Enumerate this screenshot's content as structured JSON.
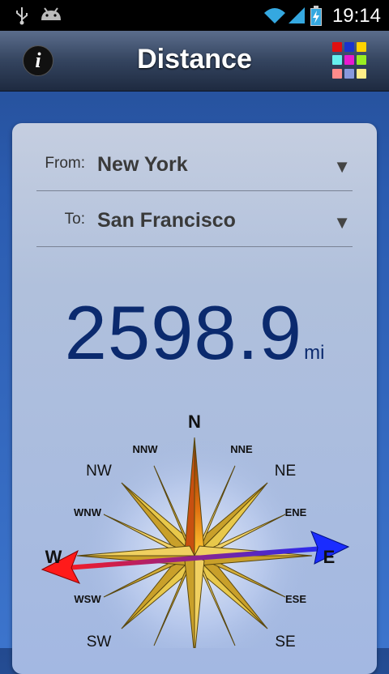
{
  "status_bar": {
    "time": "19:14",
    "left_icons": [
      "usb-icon",
      "android-icon"
    ],
    "right_icons": [
      "wifi-icon",
      "signal-icon",
      "battery-charging-icon"
    ]
  },
  "header": {
    "title": "Distance",
    "info_label": "i",
    "menu_colors": [
      "#e01010",
      "#1a33cc",
      "#ffd400",
      "#66f0ee",
      "#e81ad0",
      "#99ee22",
      "#ff8b8b",
      "#8899dd",
      "#ffee88"
    ]
  },
  "form": {
    "from_label": "From:",
    "from_value": "New York",
    "to_label": "To:",
    "to_value": "San Francisco",
    "dropdown_glyph": "▼"
  },
  "result": {
    "distance": "2598.9",
    "unit": "mi"
  },
  "compass": {
    "labels": {
      "n": "N",
      "nne": "NNE",
      "ne": "NE",
      "ene": "ENE",
      "e": "E",
      "ese": "ESE",
      "se": "SE",
      "sw": "SW",
      "wsw": "WSW",
      "w": "W",
      "wnw": "WNW",
      "nw": "NW",
      "nnw": "NNW"
    },
    "bearing_from_color": "#ff1a1a",
    "bearing_to_color": "#1a2cff"
  }
}
